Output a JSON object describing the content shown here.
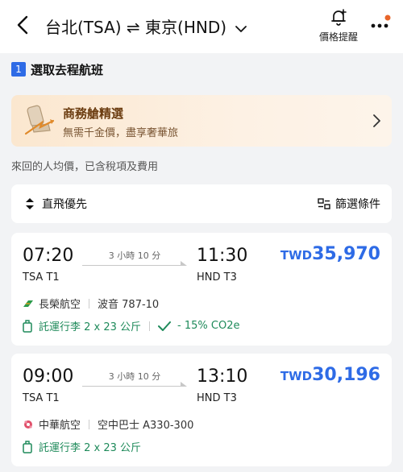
{
  "header": {
    "route_title": "台北(TSA) ⇌ 東京(HND)",
    "price_alert_label": "價格提醒"
  },
  "section": {
    "step": "1",
    "title": "選取去程航班"
  },
  "promo": {
    "title": "商務艙精選",
    "subtitle": "無需千金價，盡享奢華旅"
  },
  "avg_note": "來回的人均價，已含稅項及費用",
  "filter_bar": {
    "sort_label": "直飛優先",
    "filter_label": "篩選條件"
  },
  "flights": [
    {
      "dep_time": "07:20",
      "arr_time": "11:30",
      "dep_airport": "TSA T1",
      "arr_airport": "HND T3",
      "duration": "3 小時 10 分",
      "currency": "TWD",
      "price": "35,970",
      "airline": "長榮航空",
      "aircraft": "波音 787-10",
      "baggage": "託運行李 2 x 23 公斤",
      "co2": "- 15% CO2e"
    },
    {
      "dep_time": "09:00",
      "arr_time": "13:10",
      "dep_airport": "TSA T1",
      "arr_airport": "HND T3",
      "duration": "3 小時 10 分",
      "currency": "TWD",
      "price": "30,196",
      "airline": "中華航空",
      "aircraft": "空中巴士 A330-300",
      "baggage": "託運行李 2 x 23 公斤"
    }
  ],
  "colors": {
    "accent": "#2e6be6",
    "green": "#1e8a5a",
    "notification_dot": "#e8652a"
  }
}
